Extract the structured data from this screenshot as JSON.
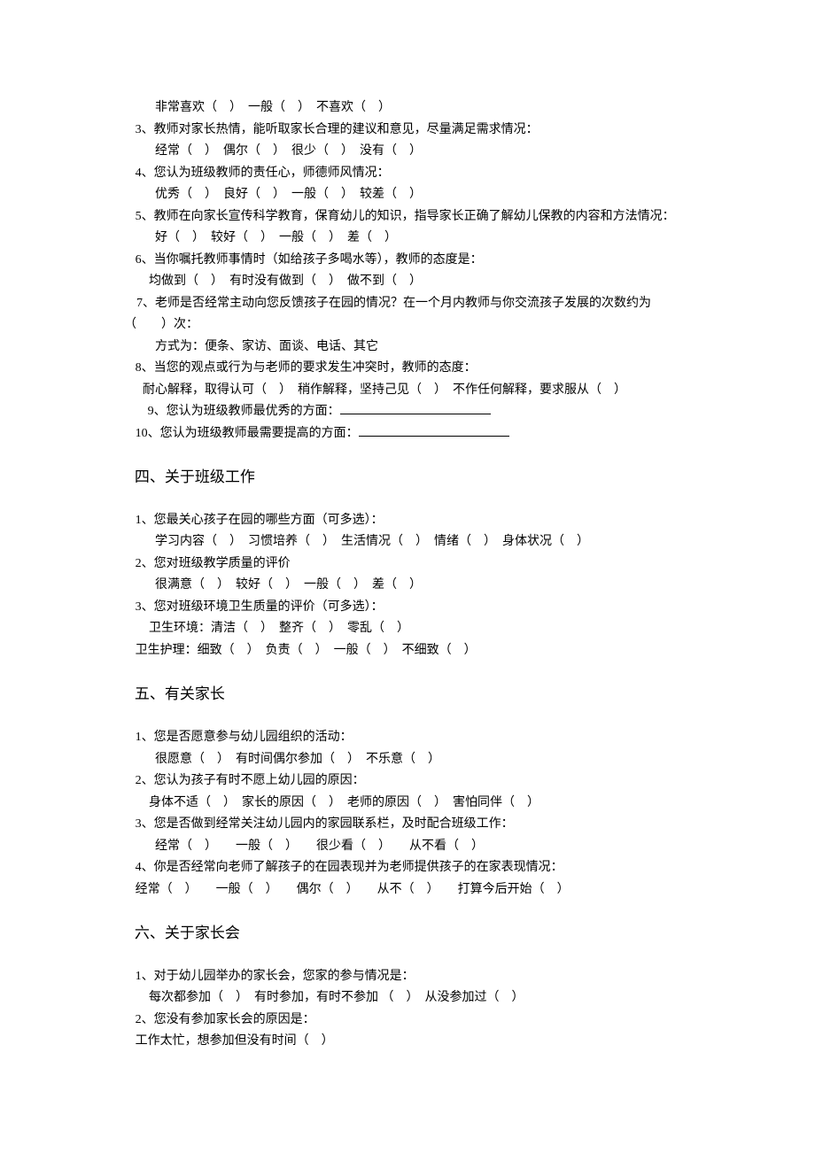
{
  "q_pre_opts": "非常喜欢（　）　一般（　）　不喜欢（　）",
  "q3": "3、教师对家长热情，能听取家长合理的建议和意见，尽量满足需求情况：",
  "q3_opts": "经常（　）　偶尔（　）　很少（　）　没有（　）",
  "q4": "4、您认为班级教师的责任心，师德师风情况：",
  "q4_opts": "优秀（　）　良好（　）　一般（　）　较差（　）",
  "q5": "5、教师在向家长宣传科学教育，保育幼儿的知识，指导家长正确了解幼儿保教的内容和方法情况：",
  "q5_opts": "好（　）　较好（　）　一般（　）　差（　）",
  "q6": "6、当你嘱托教师事情时（如给孩子多喝水等），教师的态度是：",
  "q6_opts": "均做到（　）　有时没有做到（　）　做不到（　）",
  "q7": "　7、老师是否经常主动向您反馈孩子在园的情况？在一个月内教师与你交流孩子发展的次数约为（　　）次：",
  "q7_opts": "方式为：便条、家访、面谈、电话、其它",
  "q8": "8、当您的观点或行为与老师的要求发生冲突时，教师的态度：",
  "q8_opts": "耐心解释，取得认可（　）　稍作解释，坚持己见（　）　不作任何解释，要求服从（　）",
  "q9": "　9、您认为班级教师最优秀的方面：",
  "q10": "10、您认为班级教师最需要提高的方面：",
  "sec4": "四、关于班级工作",
  "s4q1": "1、您最关心孩子在园的哪些方面（可多选）：",
  "s4q1_opts": "学习内容（　）　习惯培养（　）　生活情况（　）　情绪（　）　身体状况（　）",
  "s4q2": "2、您对班级教学质量的评价",
  "s4q2_opts": "很满意（　）　较好（　）　一般（　）　差（　）",
  "s4q3": "3、您对班级环境卫生质量的评价（可多选）：",
  "s4q3_opts1": "卫生环境：清洁（　）　整齐（　）　零乱（　）",
  "s4q3_opts2": "卫生护理：细致（　）　负责（　）　一般（　）　不细致（　）",
  "sec5": "五、有关家长",
  "s5q1": "1、您是否愿意参与幼儿园组织的活动：",
  "s5q1_opts": "很愿意（　）　有时间偶尔参加（　）　不乐意（　）",
  "s5q2": "2、您认为孩子有时不愿上幼儿园的原因：",
  "s5q2_opts": "身体不适（　）　家长的原因（　）　老师的原因（　）　害怕同伴（　）",
  "s5q3": "3、您是否做到经常关注幼儿园内的家园联系栏，及时配合班级工作：",
  "s5q3_opts": "经常（　）　　一般（　）　　很少看（　）　　从不看（　）",
  "s5q4": "4、你是否经常向老师了解孩子的在园表现并为老师提供孩子的在家表现情况：",
  "s5q4_opts": "经常（　）　　一般（　）　　偶尔（　）　　从不（　）　　打算今后开始（　）",
  "sec6": "六、关于家长会",
  "s6q1": "1、对于幼儿园举办的家长会，您家的参与情况是：",
  "s6q1_opts": "每次都参加（　）　有时参加，有时不参加 （　）　从没参加过（　）",
  "s6q2": "2、您没有参加家长会的原因是：",
  "s6q2_opts": "工作太忙，想参加但没有时间（　）"
}
